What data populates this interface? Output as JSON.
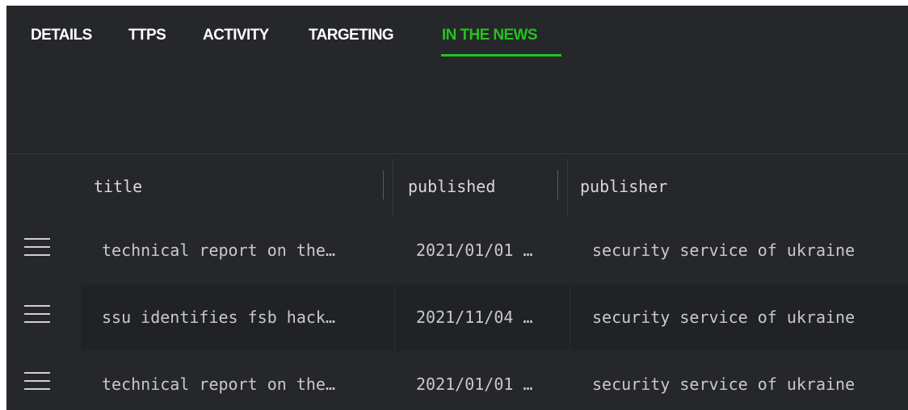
{
  "tabs": [
    {
      "label": "DETAILS",
      "active": false
    },
    {
      "label": "TTPS",
      "active": false
    },
    {
      "label": "ACTIVITY",
      "active": false
    },
    {
      "label": "TARGETING",
      "active": false
    },
    {
      "label": "IN THE NEWS",
      "active": true
    }
  ],
  "colors": {
    "accent": "#22c21e",
    "background": "#26272a",
    "row_alt": "#202225"
  },
  "table": {
    "columns": [
      "title",
      "published",
      "publisher"
    ],
    "rows": [
      {
        "title": "technical report on the…",
        "published": "2021/01/01 …",
        "publisher": "security service of ukraine"
      },
      {
        "title": "ssu identifies fsb hack…",
        "published": "2021/11/04 …",
        "publisher": "security service of ukraine"
      },
      {
        "title": "technical report on the…",
        "published": "2021/01/01 …",
        "publisher": "security service of ukraine"
      }
    ],
    "row_icon": "drag-handle-icon"
  }
}
